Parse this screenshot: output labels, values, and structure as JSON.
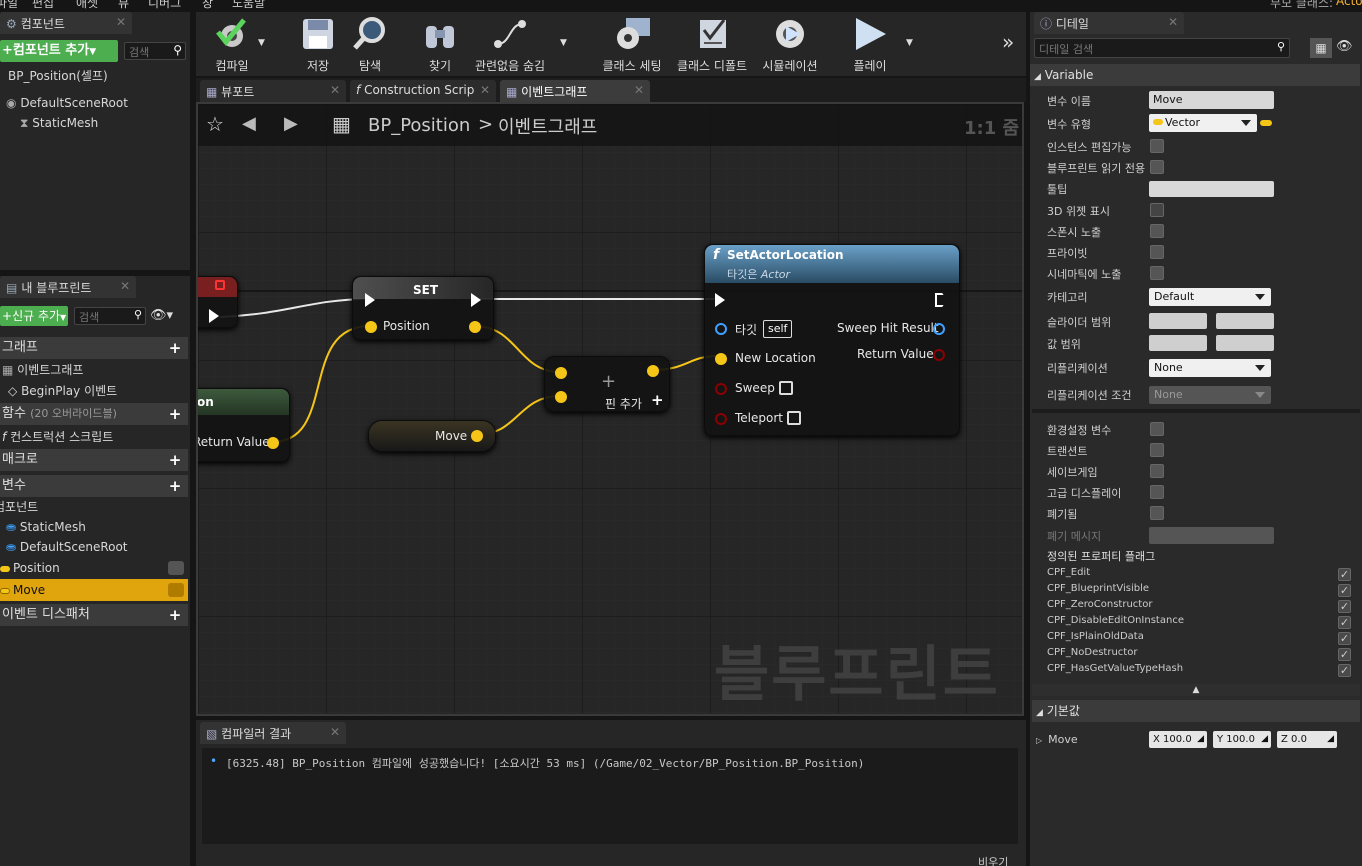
{
  "menubar": {
    "items": [
      "파일",
      "편집",
      "애셋",
      "뷰",
      "디버그",
      "창",
      "도움말"
    ],
    "parent_class_label": "부모 클래스:",
    "parent_class_value": "Actor"
  },
  "components": {
    "tab_label": "컴포넌트",
    "add_button": "컴포넌트 추가",
    "search_placeholder": "검색",
    "self_item": "BP_Position(셀프)",
    "tree": [
      "DefaultSceneRoot",
      "StaticMesh"
    ]
  },
  "my_blueprint": {
    "tab_label": "내 블루프린트",
    "add_new": "신규 추가",
    "search_placeholder": "검색",
    "sections": {
      "graphs": "그래프",
      "event_graph": "이벤트그래프",
      "begin_play": "BeginPlay 이벤트",
      "functions": "함수",
      "functions_override": "(20 오버라이드블)",
      "construction_script": "컨스트럭션 스크립트",
      "macros": "매크로",
      "variables": "변수",
      "components_cat": "컴포넌트",
      "var_static_mesh": "StaticMesh",
      "var_default_root": "DefaultSceneRoot",
      "var_position": "Position",
      "var_move": "Move",
      "event_dispatchers": "이벤트 디스패처"
    }
  },
  "toolbar": {
    "compile": "컴파일",
    "save": "저장",
    "browse": "탐색",
    "find": "찾기",
    "hide_unrelated": "관련없음 숨김",
    "class_settings": "클래스 세팅",
    "class_defaults": "클래스 디폴트",
    "simulation": "시뮬레이션",
    "play": "플레이"
  },
  "doc_tabs": [
    "뷰포트",
    "Construction Scrip",
    "이벤트그래프"
  ],
  "graph": {
    "breadcrumb_bp": "BP_Position",
    "breadcrumb_sep": ">",
    "breadcrumb_graph": "이벤트그래프",
    "zoom": "1:1 줌",
    "watermark": "블루프린트",
    "set_node": {
      "title": "SET",
      "pin": "Position"
    },
    "get_node": {
      "title": "on",
      "pin": "Return Value"
    },
    "move_node": {
      "pin": "Move"
    },
    "add_node": {
      "label": "핀 추가"
    },
    "set_actor_location": {
      "title": "SetActorLocation",
      "subtitle_prefix": "타깃은",
      "subtitle_target": "Actor",
      "pin_target": "타깃",
      "pin_self": "self",
      "pin_new_location": "New Location",
      "pin_sweep": "Sweep",
      "pin_teleport": "Teleport",
      "out_sweep_hit": "Sweep Hit Result",
      "out_return": "Return Value"
    }
  },
  "compiler": {
    "tab_label": "컴파일러 결과",
    "message": "[6325.48] BP_Position 컴파일에 성공했습니다! [소요시간 53 ms] (/Game/02_Vector/BP_Position.BP_Position)",
    "clear_button": "비우기"
  },
  "details": {
    "tab_label": "디테일",
    "search_placeholder": "디테일 검색",
    "variable_section": "Variable",
    "var_name_label": "변수 이름",
    "var_name_value": "Move",
    "var_type_label": "변수 유형",
    "var_type_value": "Vector",
    "instance_editable": "인스턴스 편집가능",
    "bp_readonly": "블루프린트 읽기 전용",
    "tooltip": "툴팁",
    "widget3d": "3D 위젯 표시",
    "expose_spawn": "스폰시 노출",
    "private": "프라이빗",
    "expose_cinematics": "시네마틱에 노출",
    "category": "카테고리",
    "category_value": "Default",
    "slider_range": "슬라이더 범위",
    "value_range": "값 범위",
    "replication": "리플리케이션",
    "replication_value": "None",
    "replication_condition": "리플리케이션 조건",
    "replication_condition_value": "None",
    "config_var": "환경설정 변수",
    "transient": "트랜션트",
    "savegame": "세이브게임",
    "advanced_display": "고급 디스플레이",
    "deprecated": "폐기됨",
    "deprecation_msg": "폐기 메시지",
    "defined_flags": "정의된 프로퍼티 플래그",
    "flags": [
      "CPF_Edit",
      "CPF_BlueprintVisible",
      "CPF_ZeroConstructor",
      "CPF_DisableEditOnInstance",
      "CPF_IsPlainOldData",
      "CPF_NoDestructor",
      "CPF_HasGetValueTypeHash"
    ],
    "default_section": "기본값",
    "default_move_label": "Move",
    "default_x_label": "X",
    "default_x_value": "100.0",
    "default_y_label": "Y",
    "default_y_value": "100.0",
    "default_z_label": "Z",
    "default_z_value": "0.0"
  },
  "colors": {
    "exec_white": "#ffffff",
    "vector_pin": "#f5c518",
    "object_pin": "#3ea0ff",
    "bool_pin": "#8b0000",
    "var_move_highlight": "#e0a40c",
    "add_green": "#4cae4f"
  }
}
